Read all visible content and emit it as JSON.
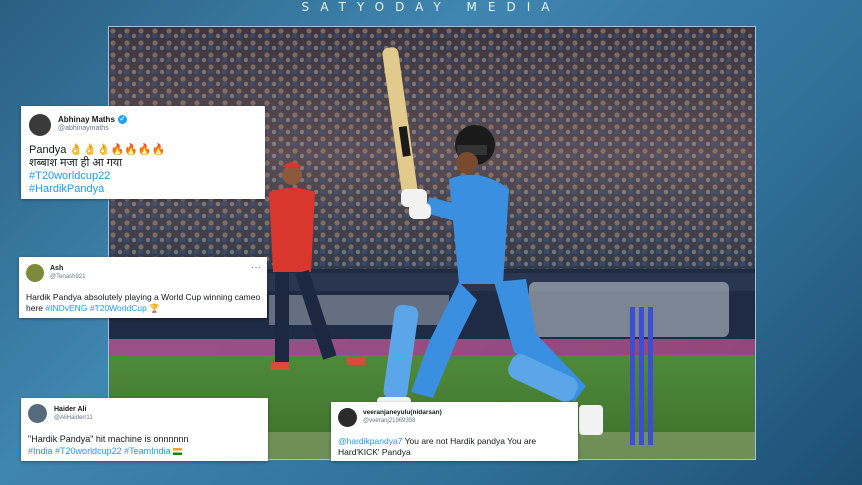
{
  "brand": "SATYODAY MEDIA",
  "tweets": [
    {
      "name": "Abhinay Maths",
      "handle": "@abhinaymaths",
      "verified": true,
      "line1": "Pandya 👌👌👌🔥🔥🔥🔥",
      "line2": "शब्बाश मजा ही आ गया",
      "tag1": "#T20worldcup22",
      "tag2": "#HardikPandya"
    },
    {
      "name": "Ash",
      "handle": "@Tenash921",
      "text": "Hardik Pandya absolutely playing a World Cup winning cameo here",
      "tag1": "#INDvENG",
      "tag2": "#T20WorldCup",
      "emoji": "🏆"
    },
    {
      "name": "Haider Ali",
      "handle": "@AliHaiderr11",
      "text": "\"Hardik Pandya\" hit machine is onnnnnn",
      "tag1": "#India",
      "tag2": "#T20worldcup22",
      "tag3": "#TeamIndia"
    },
    {
      "name": "veeranjaneyulu(nidarsan)",
      "handle": "@veeranj21969358",
      "mention": "@hardikpandya7",
      "text": "You are not Hardik pandya You are Hard'KICK' Pandya"
    }
  ],
  "icons": {
    "verified": "verified-badge-icon",
    "more": "more-options-icon",
    "flag": "india-flag-icon"
  },
  "colors": {
    "hashtag": "#1d9bf0",
    "jersey": "#3a8fe0",
    "england": "#d9362e"
  }
}
